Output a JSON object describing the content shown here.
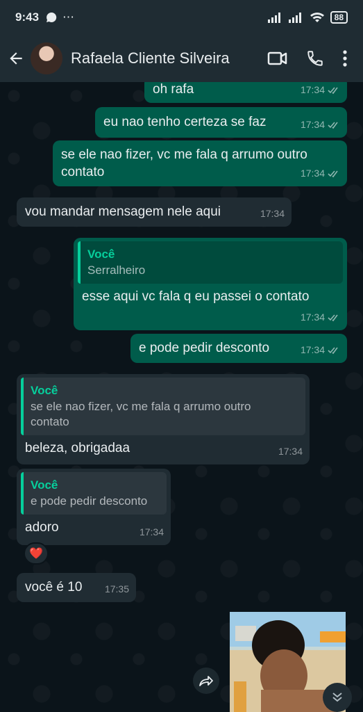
{
  "status_bar": {
    "time": "9:43",
    "dots": "⋯",
    "battery": "88"
  },
  "header": {
    "contact_name": "Rafaela Cliente Silveira"
  },
  "messages": [
    {
      "direction": "out",
      "text": "oh rafa",
      "time": "17:34"
    },
    {
      "direction": "out",
      "text": "eu nao tenho certeza se faz",
      "time": "17:34"
    },
    {
      "direction": "out",
      "text": "se ele nao fizer, vc me fala q arrumo outro contato",
      "time": "17:34"
    },
    {
      "direction": "in",
      "text": "vou mandar mensagem nele aqui",
      "time": "17:34"
    },
    {
      "direction": "out",
      "quote_author": "Você",
      "quote_text": "Serralheiro",
      "text": "esse aqui vc fala q eu passei o contato",
      "time": "17:34"
    },
    {
      "direction": "out",
      "text": "e pode pedir desconto",
      "time": "17:34"
    },
    {
      "direction": "in",
      "quote_author": "Você",
      "quote_text": "se ele nao fizer, vc me fala q arrumo outro contato",
      "text": "beleza, obrigadaa",
      "time": "17:34"
    },
    {
      "direction": "in",
      "quote_author": "Você",
      "quote_text": "e pode pedir desconto",
      "text": "adoro",
      "time": "17:34",
      "reaction": "❤️"
    },
    {
      "direction": "in",
      "text": "você é 10",
      "time": "17:35"
    }
  ],
  "colors": {
    "outgoing": "#005c4b",
    "incoming": "#202c33",
    "accent": "#06cf9c",
    "background": "#0b141a"
  }
}
